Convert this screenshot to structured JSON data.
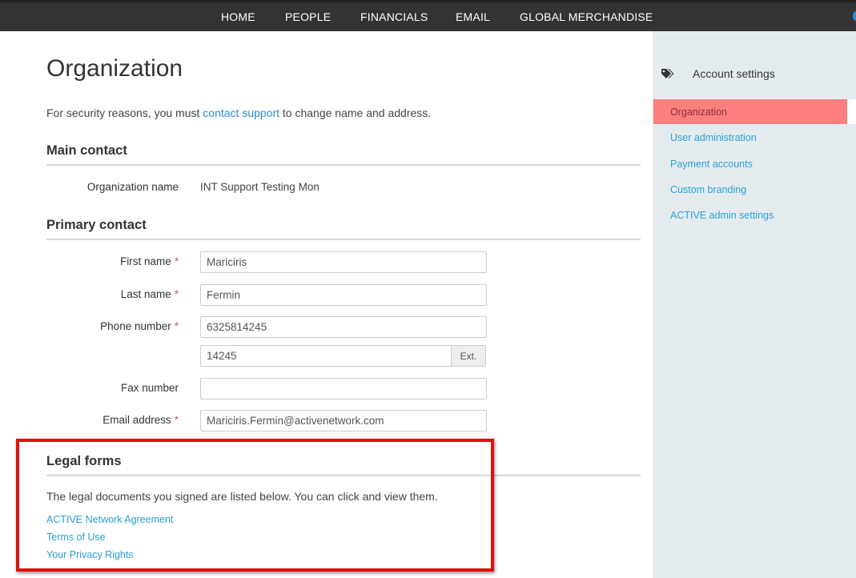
{
  "nav": {
    "items": [
      "HOME",
      "PEOPLE",
      "FINANCIALS",
      "EMAIL",
      "GLOBAL MERCHANDISE"
    ]
  },
  "page": {
    "title": "Organization",
    "intro_before": "For security reasons, you must ",
    "intro_link": "contact support",
    "intro_after": " to change name and address."
  },
  "main_contact": {
    "title": "Main contact",
    "org_label": "Organization name",
    "org_value": "INT Support Testing Mon"
  },
  "primary_contact": {
    "title": "Primary contact",
    "first_name_label": "First name",
    "first_name_value": "Mariciris",
    "last_name_label": "Last name",
    "last_name_value": "Fermin",
    "phone_label": "Phone number",
    "phone_value": "6325814245",
    "ext_value": "14245",
    "ext_label": "Ext.",
    "fax_label": "Fax number",
    "fax_value": "",
    "email_label": "Email address",
    "email_value": "Mariciris.Fermin@activenetwork.com",
    "required_mark": "*"
  },
  "legal": {
    "title": "Legal forms",
    "description": "The legal documents you signed are listed below. You can click and view them.",
    "links": [
      "ACTIVE Network Agreement",
      "Terms of Use",
      "Your Privacy Rights"
    ]
  },
  "sidebar": {
    "heading": "Account settings",
    "heading_icon": "tags-icon",
    "items": [
      "Organization",
      "User administration",
      "Payment accounts",
      "Custom branding",
      "ACTIVE admin settings"
    ],
    "selected": "Organization"
  },
  "colors": {
    "nav_bg": "#333333",
    "sidebar_bg": "#e5ecef",
    "active_item_bg": "#ff7f7f",
    "link": "#2a9fd6",
    "required": "#d9534f",
    "highlight_border": "#e01010"
  }
}
